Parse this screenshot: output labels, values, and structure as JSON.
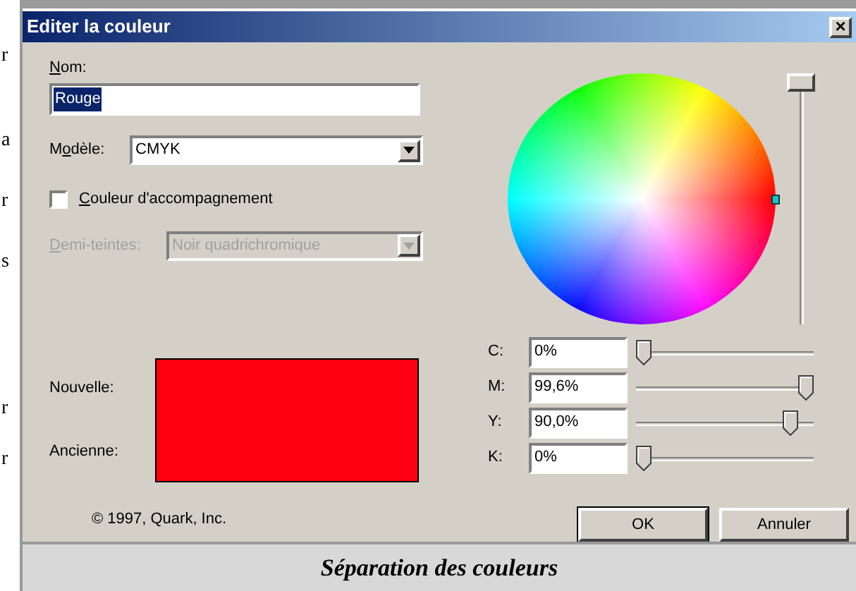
{
  "margin_text": [
    "r",
    "a",
    "r",
    "s",
    "r",
    "r"
  ],
  "window": {
    "title": "Editer la couleur",
    "close": "×"
  },
  "name_field": {
    "label": "Nom:",
    "value": "Rouge",
    "selected": true
  },
  "model": {
    "label": "Modèle:",
    "value": "CMYK"
  },
  "spot_color": {
    "label": "Couleur d'accompagnement",
    "checked": false
  },
  "halftone": {
    "label": "Demi-teintes:",
    "value": "Noir quadrichromique",
    "disabled": true
  },
  "samples": [
    {
      "label": "Nouvelle:",
      "color": "#ff0010"
    },
    {
      "label": "Ancienne:",
      "color": "#ff0010"
    }
  ],
  "copyright": "© 1997, Quark, Inc.",
  "brightness": {
    "level": 1
  },
  "channels": [
    {
      "label": "C:",
      "value": "0%",
      "level": 0
    },
    {
      "label": "M:",
      "value": "99,6%",
      "level": 0.996
    },
    {
      "label": "Y:",
      "value": "90,0%",
      "level": 0.9
    },
    {
      "label": "K:",
      "value": "0%",
      "level": 0
    }
  ],
  "buttons": [
    {
      "label": "OK",
      "default": true
    },
    {
      "label": "Annuler",
      "default": false
    }
  ],
  "caption": "Séparation des couleurs"
}
